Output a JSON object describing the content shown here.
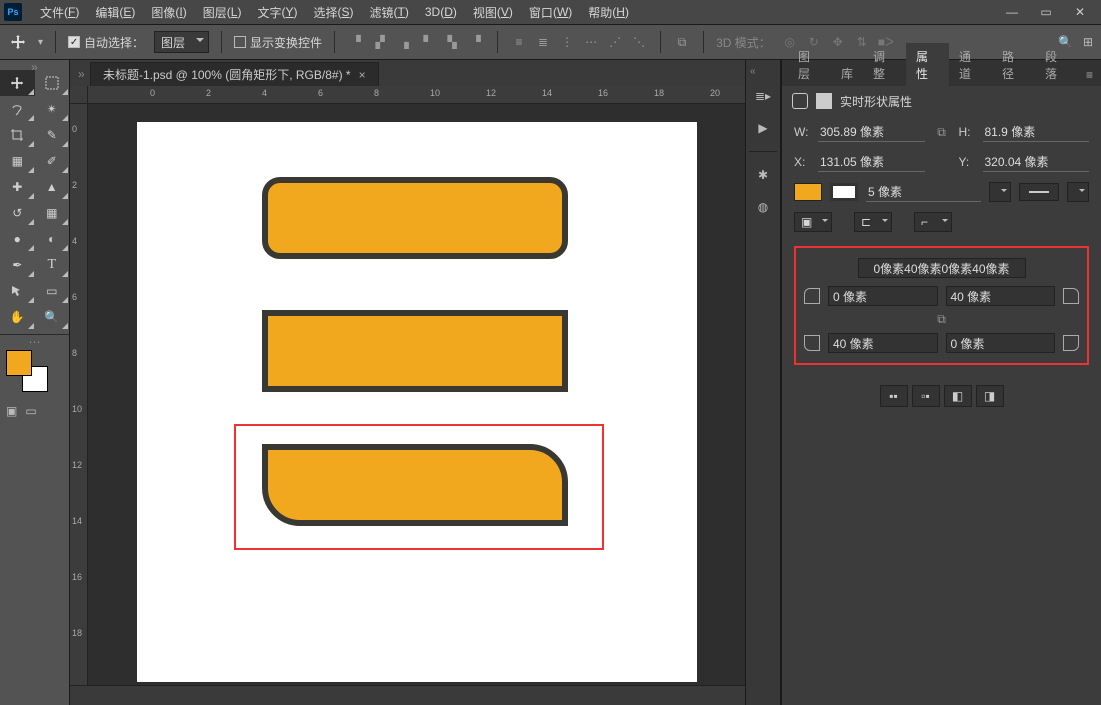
{
  "app": {
    "name": "Ps"
  },
  "menu": {
    "items": [
      {
        "label": "文件",
        "mn": "F"
      },
      {
        "label": "编辑",
        "mn": "E"
      },
      {
        "label": "图像",
        "mn": "I"
      },
      {
        "label": "图层",
        "mn": "L"
      },
      {
        "label": "文字",
        "mn": "Y"
      },
      {
        "label": "选择",
        "mn": "S"
      },
      {
        "label": "滤镜",
        "mn": "T"
      },
      {
        "label": "3D",
        "mn": "D"
      },
      {
        "label": "视图",
        "mn": "V"
      },
      {
        "label": "窗口",
        "mn": "W"
      },
      {
        "label": "帮助",
        "mn": "H"
      }
    ]
  },
  "options": {
    "autoSelectLabel": "自动选择：",
    "autoSelectTarget": "图层",
    "showTransformLabel": "显示变换控件",
    "mode3dLabel": "3D 模式："
  },
  "document": {
    "tab": "未标题-1.psd @ 100% (圆角矩形下, RGB/8#) *"
  },
  "rulerH": [
    "0",
    "2",
    "4",
    "6",
    "8",
    "10",
    "12",
    "14",
    "16",
    "18",
    "20"
  ],
  "rulerV": [
    "0",
    "2",
    "4",
    "6",
    "8",
    "10",
    "12",
    "14",
    "16",
    "18"
  ],
  "panels": {
    "tabs": [
      "图层",
      "库",
      "调整",
      "属性",
      "通道",
      "路径",
      "段落"
    ],
    "active": 3
  },
  "props": {
    "title": "实时形状属性",
    "wLabel": "W:",
    "wVal": "305.89 像素",
    "hLabel": "H:",
    "hVal": "81.9 像素",
    "xLabel": "X:",
    "xVal": "131.05 像素",
    "yLabel": "Y:",
    "yVal": "320.04 像素",
    "strokeWidth": "5 像素",
    "radiiText": "0像素40像素0像素40像素",
    "r_tl": "0 像素",
    "r_tr": "40 像素",
    "r_bl": "40 像素",
    "r_br": "0 像素",
    "linkGlyph": "⧉"
  },
  "colors": {
    "orange": "#f2a81e"
  }
}
